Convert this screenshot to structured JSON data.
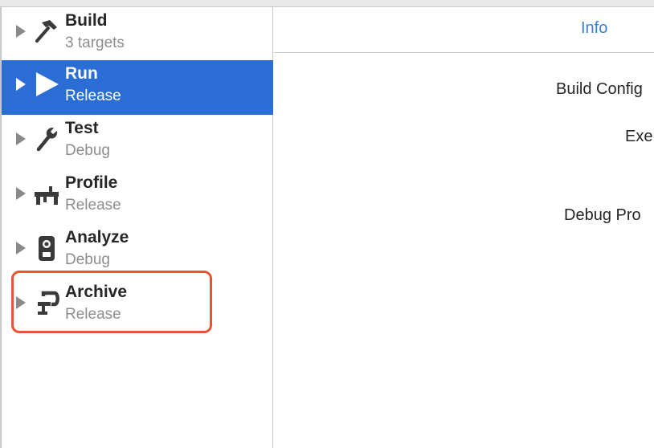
{
  "sidebar": {
    "items": [
      {
        "title": "Build",
        "subtitle": "3 targets",
        "icon": "hammer-icon"
      },
      {
        "title": "Run",
        "subtitle": "Release",
        "icon": "play-icon"
      },
      {
        "title": "Test",
        "subtitle": "Debug",
        "icon": "wrench-icon"
      },
      {
        "title": "Profile",
        "subtitle": "Release",
        "icon": "gauge-icon"
      },
      {
        "title": "Analyze",
        "subtitle": "Debug",
        "icon": "analyze-icon"
      },
      {
        "title": "Archive",
        "subtitle": "Release",
        "icon": "clamp-icon"
      }
    ],
    "selected": "Run"
  },
  "main": {
    "tabs": [
      {
        "label": "Info"
      }
    ],
    "fields": [
      {
        "label": "Build Config"
      },
      {
        "label": "Exe"
      },
      {
        "label": "Debug Pro"
      }
    ]
  },
  "colors": {
    "selection": "#2a6dd4",
    "tab_accent": "#3a80d2",
    "highlight_box": "#e65533"
  }
}
